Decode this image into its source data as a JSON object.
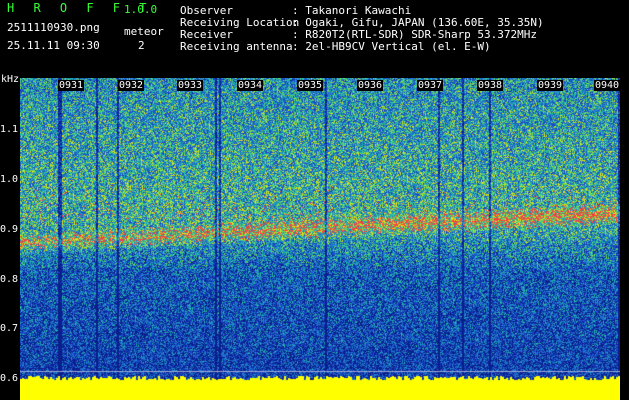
{
  "app": {
    "name": "H R O F F T",
    "version": "1.0.0",
    "file": "2511110930.png",
    "datetime": "25.11.11 09:30",
    "count_label": "meteor",
    "count_value": "2"
  },
  "info": [
    {
      "label": "Observer",
      "value": ": Takanori Kawachi"
    },
    {
      "label": "Receiving Location",
      "value": ": Ogaki, Gifu, JAPAN (136.60E, 35.35N)"
    },
    {
      "label": "Receiver",
      "value": ": R820T2(RTL-SDR) SDR-Sharp 53.372MHz"
    },
    {
      "label": "Receiving antenna",
      "value": ": 2el-HB9CV Vertical (el. E-W)"
    }
  ],
  "spectrogram": {
    "unit": "kHz",
    "x_ticks": [
      "0931",
      "0932",
      "0933",
      "0934",
      "0935",
      "0936",
      "0937",
      "0938",
      "0939",
      "0940"
    ],
    "y_ticks": [
      "1.1",
      "1.0",
      "0.9",
      "0.8",
      "0.7",
      "0.6"
    ],
    "colors": {
      "background": "#041a86",
      "noise_low": "#1d4fd0",
      "noise_mid": "#1fb0a8",
      "noise_high": "#e6e600",
      "band": "#ff3a3a",
      "baseline": "#ffff00"
    }
  }
}
